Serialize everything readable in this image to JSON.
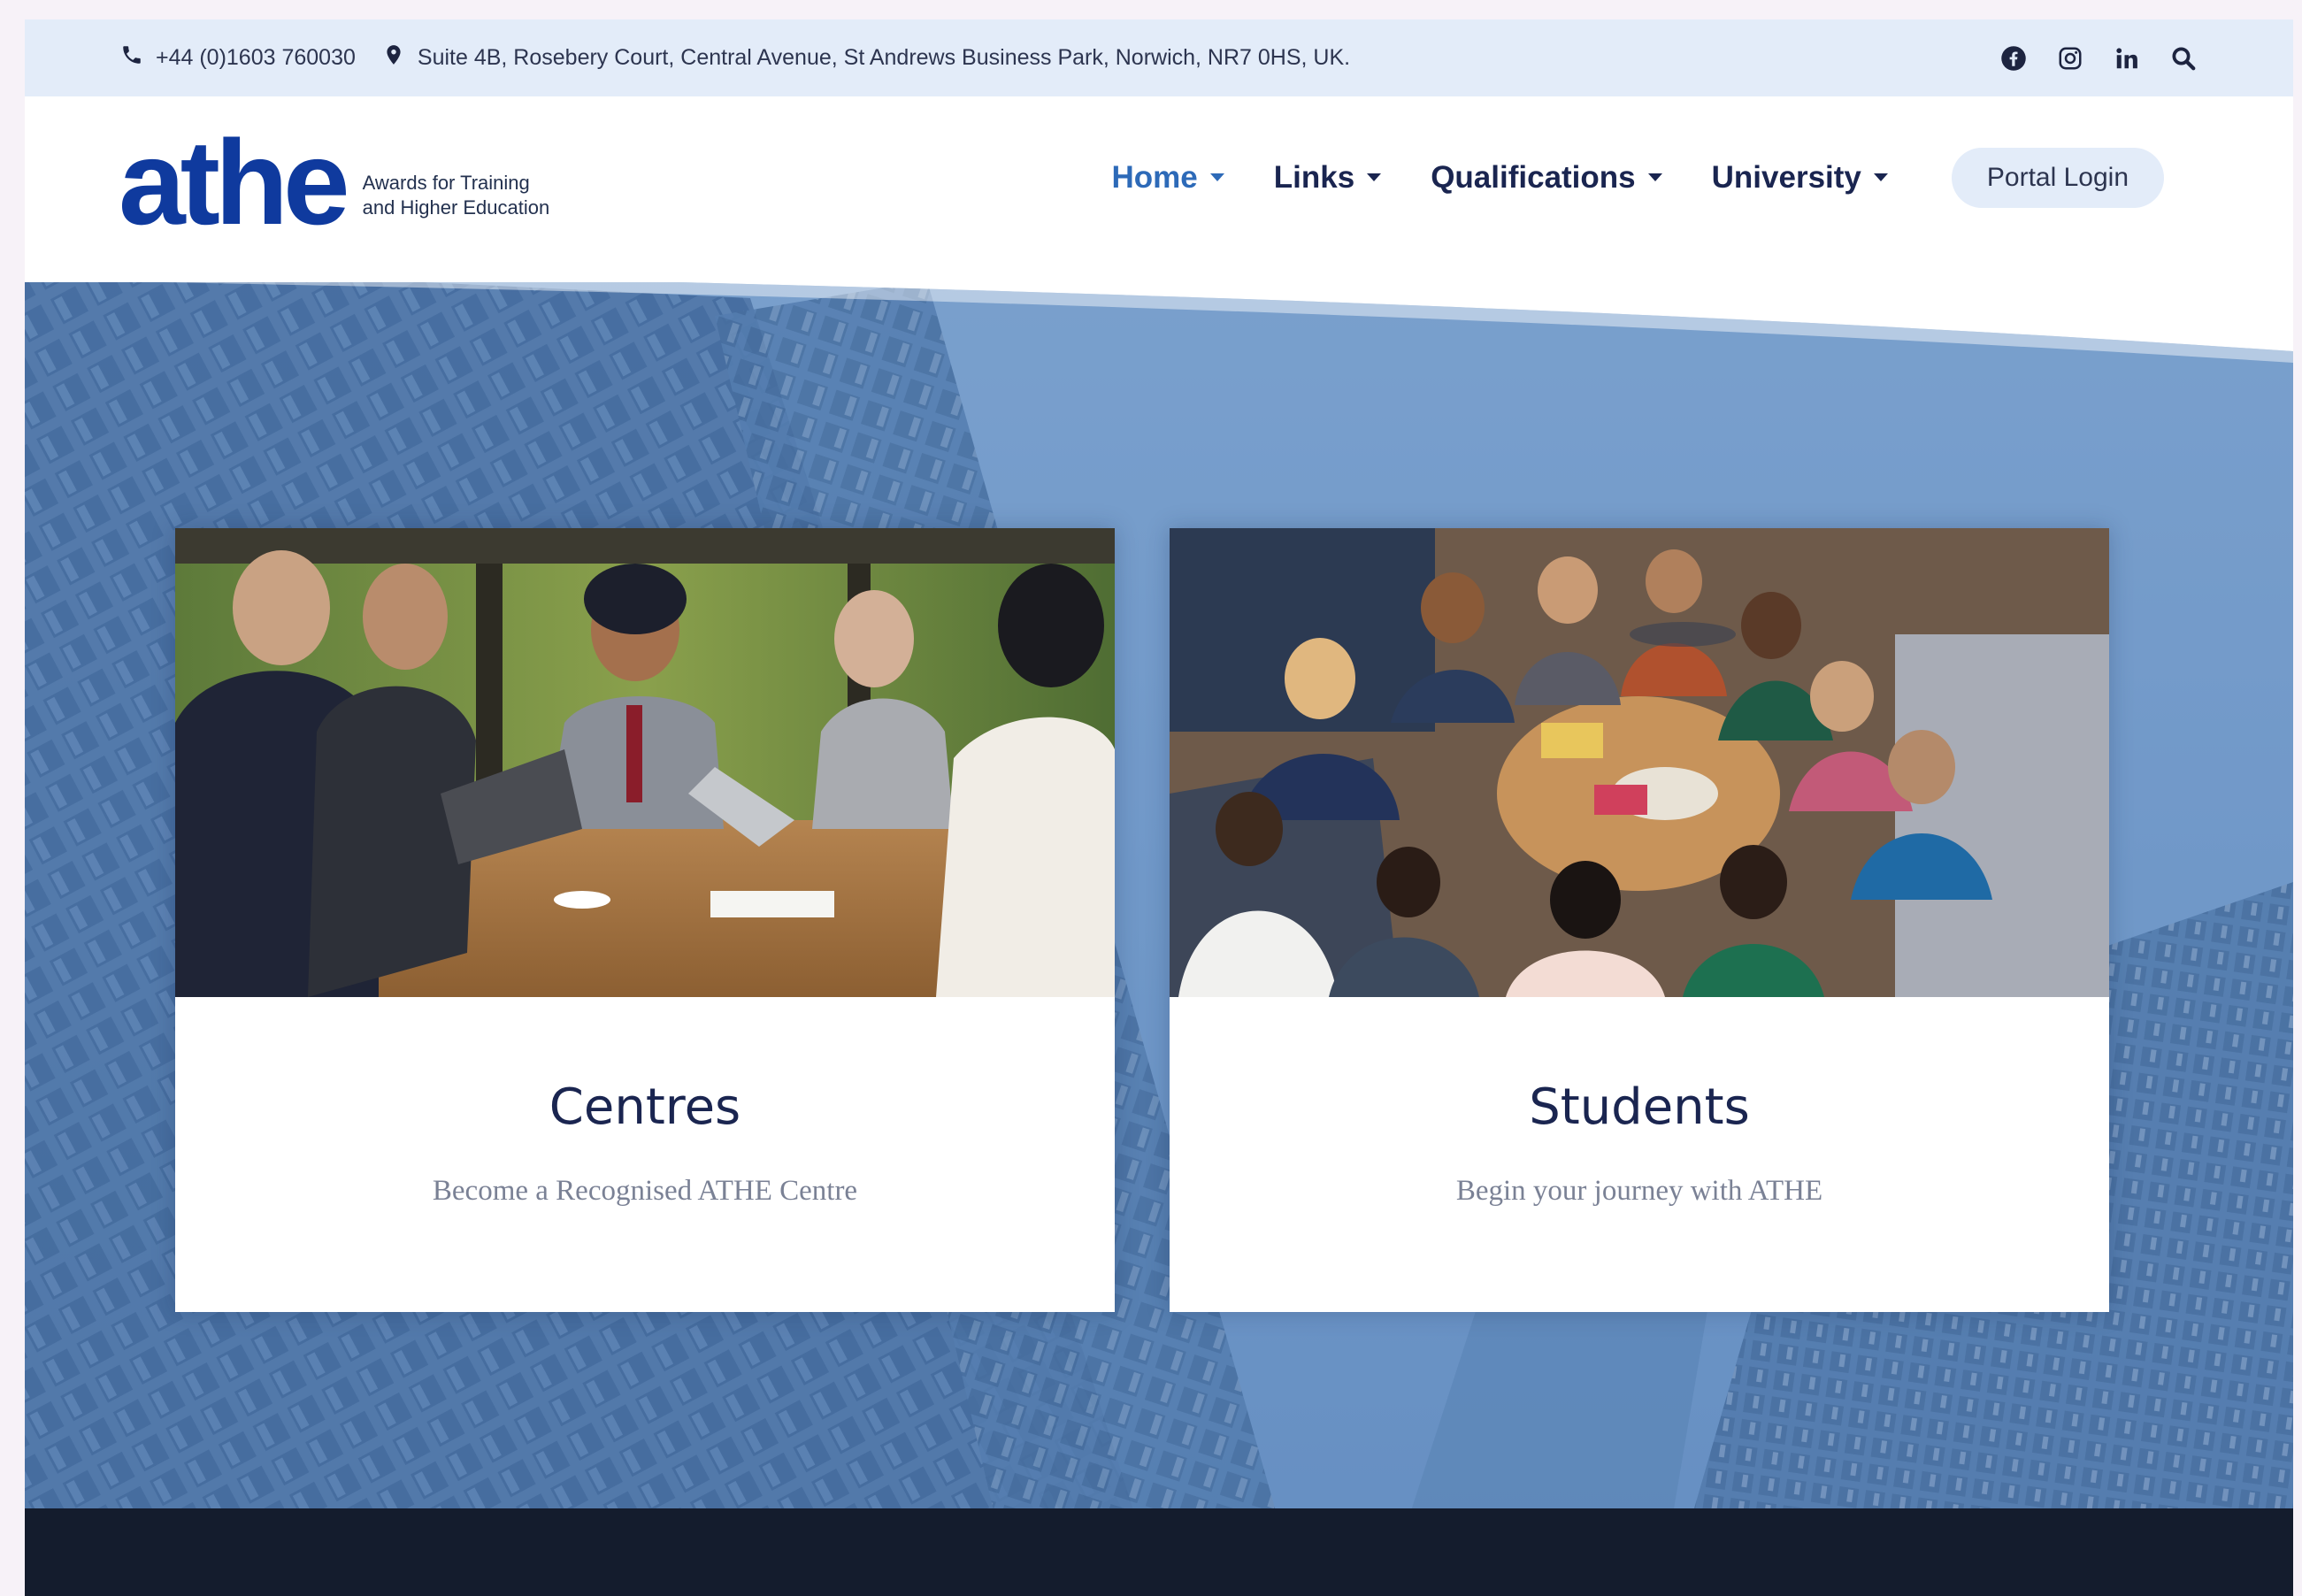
{
  "topbar": {
    "phone": "+44 (0)1603 760030",
    "address": "Suite 4B, Rosebery Court, Central Avenue, St Andrews Business Park, Norwich, NR7 0HS, UK.",
    "icons": [
      "phone-icon",
      "location-pin-icon",
      "facebook-icon",
      "instagram-icon",
      "linkedin-icon",
      "search-icon"
    ]
  },
  "logo": {
    "wordmark": "athe",
    "tagline_line1": "Awards for Training",
    "tagline_line2": "and Higher Education",
    "color": "#0f3a9e"
  },
  "nav": {
    "items": [
      {
        "label": "Home",
        "active": true
      },
      {
        "label": "Links",
        "active": false
      },
      {
        "label": "Qualifications",
        "active": false
      },
      {
        "label": "University",
        "active": false
      }
    ],
    "portal_login": "Portal Login",
    "active_color": "#2d6ab8"
  },
  "cards": [
    {
      "title": "Centres",
      "subtitle": "Become a Recognised ATHE Centre",
      "image": "business-meeting-photo"
    },
    {
      "title": "Students",
      "subtitle": "Begin your journey with ATHE",
      "image": "students-group-photo"
    }
  ],
  "colors": {
    "topbar_bg": "#e3ecf9",
    "hero_blue": "#5e8bbf",
    "footer_bg": "#141c2d",
    "heading": "#1a2550"
  }
}
